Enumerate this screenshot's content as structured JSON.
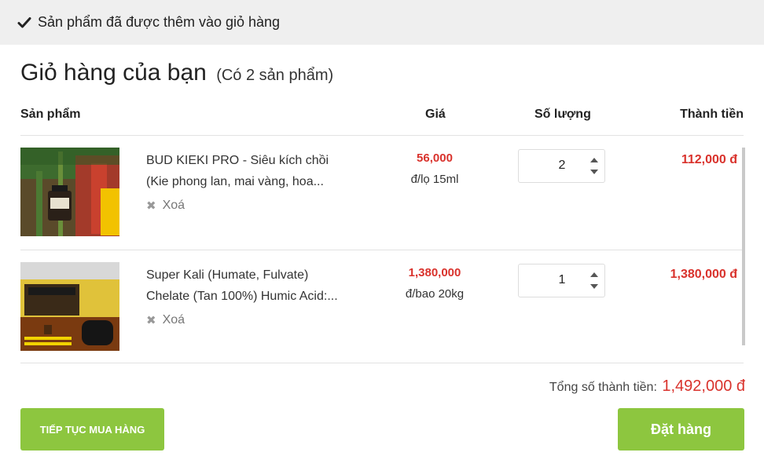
{
  "notice": {
    "icon": "check-icon",
    "message": "Sản phẩm đã được thêm vào giỏ hàng"
  },
  "cart": {
    "title": "Giỏ hàng của bạn",
    "count_text": "(Có 2 sản phẩm)"
  },
  "columns": {
    "product": "Sản phẩm",
    "price": "Giá",
    "quantity": "Số lượng",
    "total": "Thành tiền"
  },
  "items": [
    {
      "name_line1": "BUD KIEKI PRO - Siêu kích chồi",
      "name_line2": "(Kie phong lan, mai vàng, hoa...",
      "remove_label": "Xoá",
      "price": "56,000",
      "unit": "đ/lọ 15ml",
      "quantity": "2",
      "line_total": "112,000 đ"
    },
    {
      "name_line1": "Super Kali (Humate, Fulvate)",
      "name_line2": "Chelate (Tan 100%) Humic Acid:...",
      "remove_label": "Xoá",
      "price": "1,380,000",
      "unit": "đ/bao 20kg",
      "quantity": "1",
      "line_total": "1,380,000 đ"
    }
  ],
  "summary": {
    "label": "Tổng số thành tiền:",
    "value": "1,492,000 đ"
  },
  "buttons": {
    "continue": "TIẾP TỤC MUA HÀNG",
    "order": "Đặt hàng"
  },
  "colors": {
    "accent_green": "#8dc63f",
    "price_red": "#d9322c",
    "notice_bg": "#efefef"
  }
}
